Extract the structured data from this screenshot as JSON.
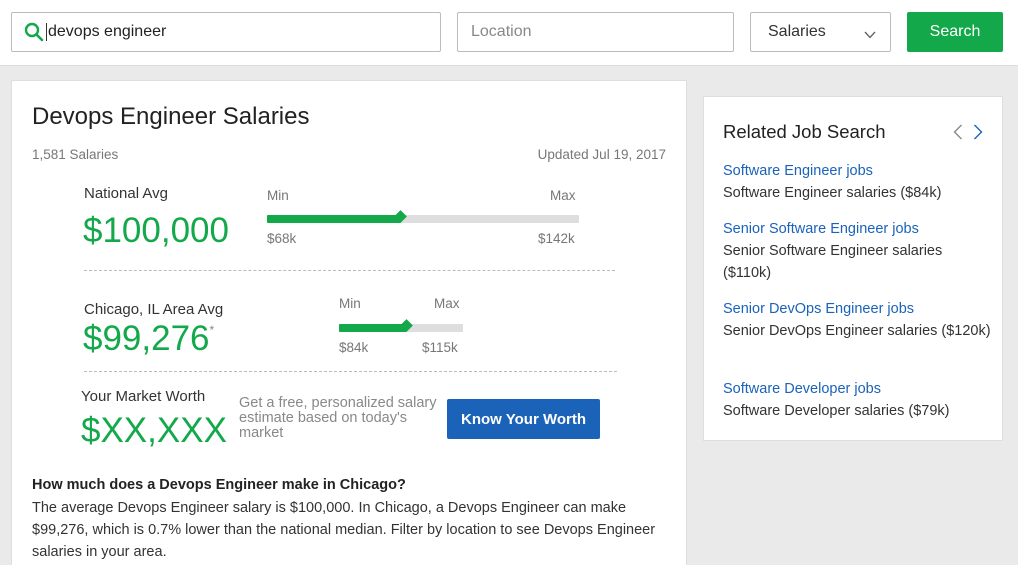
{
  "search": {
    "keyword_value": "devops engineer",
    "location_placeholder": "Location",
    "type_selected": "Salaries",
    "button_label": "Search"
  },
  "main": {
    "title": "Devops Engineer Salaries",
    "count": "1,581 Salaries",
    "updated": "Updated Jul 19, 2017",
    "national": {
      "label": "National Avg",
      "value": "$100,000",
      "min_label": "Min",
      "max_label": "Max",
      "min_value": "$68k",
      "max_value": "$142k",
      "fill_fraction": 0.43
    },
    "local": {
      "label": "Chicago, IL Area Avg",
      "value": "$99,276",
      "asterisk": "*",
      "min_label": "Min",
      "max_label": "Max",
      "min_value": "$84k",
      "max_value": "$115k",
      "fill_fraction": 0.55
    },
    "worth": {
      "label": "Your Market Worth",
      "value": "$XX,XXX",
      "text": "Get a free, personalized salary estimate based on today's market",
      "button_label": "Know Your Worth"
    },
    "faq": {
      "question": "How much does a Devops Engineer make in Chicago?",
      "answer": "The average Devops Engineer salary is $100,000. In Chicago, a Devops Engineer can make $99,276, which is 0.7% lower than the national median. Filter by location to see Devops Engineer salaries in your area."
    }
  },
  "related": {
    "title": "Related Job Search",
    "items": [
      {
        "job": "Software Engineer jobs",
        "salary": "Software Engineer salaries ($84k)"
      },
      {
        "job": "Senior Software Engineer jobs",
        "salary": "Senior Software Engineer salaries ($110k)"
      },
      {
        "job": "Senior DevOps Engineer jobs",
        "salary": "Senior DevOps Engineer salaries ($120k)"
      },
      {
        "job": "Software Developer jobs",
        "salary": "Software Developer salaries ($79k)"
      }
    ]
  },
  "colors": {
    "accent_green": "#13a84a",
    "link_blue": "#1b63b8",
    "button_blue": "#1b63b8"
  },
  "icons": {
    "search": "search-icon",
    "dropdown": "chevron-down-icon",
    "prev": "chevron-left-icon",
    "next": "chevron-right-icon"
  }
}
